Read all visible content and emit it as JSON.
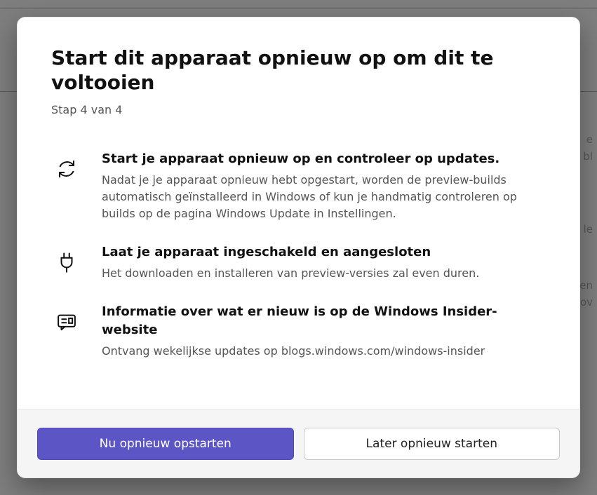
{
  "dialog": {
    "title": "Start dit apparaat opnieuw op om dit te voltooien",
    "step": "Stap 4 van 4",
    "items": [
      {
        "title": "Start je apparaat opnieuw op en controleer op updates.",
        "desc": "Nadat je je apparaat opnieuw hebt opgestart, worden de preview-builds automatisch geïnstalleerd in Windows of kun je handmatig controleren op builds op de pagina Windows Update in Instellingen."
      },
      {
        "title": "Laat je apparaat ingeschakeld en aangesloten",
        "desc": "Het downloaden en installeren van preview-versies zal even duren."
      },
      {
        "title": "Informatie over wat er nieuw is op de Windows Insider-website",
        "desc": "Ontvang wekelijkse updates op blogs.windows.com/windows-insider"
      }
    ]
  },
  "buttons": {
    "primary": "Nu opnieuw opstarten",
    "secondary": "Later opnieuw starten"
  },
  "background_hints": {
    "frag1": "e",
    "frag2": "bl",
    "frag3": "le",
    "frag4": "en",
    "frag5": "ov"
  }
}
